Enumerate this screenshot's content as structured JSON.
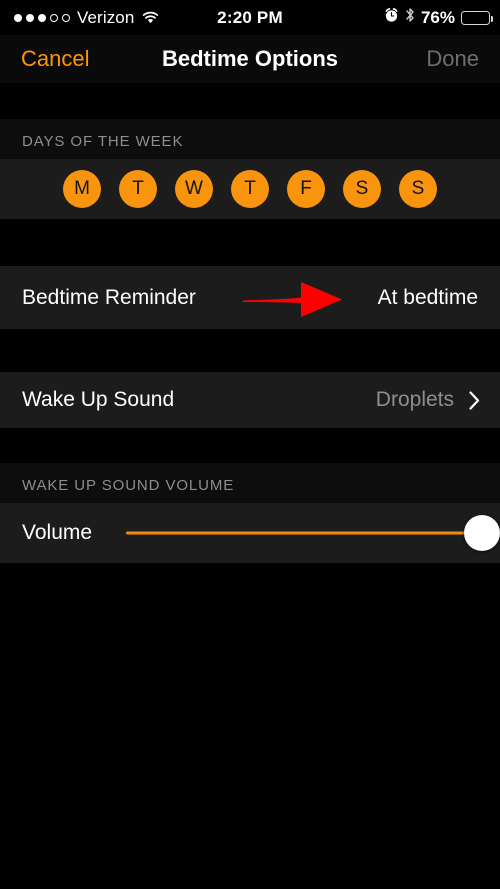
{
  "statusbar": {
    "carrier": "Verizon",
    "signal_filled": 3,
    "signal_empty": 2,
    "wifi_icon": "wifi-icon",
    "time": "2:20 PM",
    "alarm_icon": "alarm-clock-icon",
    "bluetooth_icon": "bluetooth-icon",
    "battery_percent": "76%",
    "battery_level": 76,
    "battery_color": "#ffcc00"
  },
  "navbar": {
    "cancel_label": "Cancel",
    "title": "Bedtime Options",
    "done_label": "Done",
    "accent_color": "#ff9500",
    "done_disabled_color": "#6e6e6e"
  },
  "days_section": {
    "header": "DAYS OF THE WEEK",
    "days": [
      {
        "label": "M",
        "name": "day-monday",
        "selected": true
      },
      {
        "label": "T",
        "name": "day-tuesday",
        "selected": true
      },
      {
        "label": "W",
        "name": "day-wednesday",
        "selected": true
      },
      {
        "label": "T",
        "name": "day-thursday",
        "selected": true
      },
      {
        "label": "F",
        "name": "day-friday",
        "selected": true
      },
      {
        "label": "S",
        "name": "day-saturday",
        "selected": true
      },
      {
        "label": "S",
        "name": "day-sunday",
        "selected": true
      }
    ],
    "selected_color": "#f8940d"
  },
  "bedtime_reminder": {
    "label": "Bedtime Reminder",
    "value": "At bedtime"
  },
  "wake_up_sound": {
    "label": "Wake Up Sound",
    "value": "Droplets",
    "chevron_icon": "chevron-right-icon"
  },
  "volume_section": {
    "header": "WAKE UP SOUND VOLUME",
    "label": "Volume",
    "value_percent": 100,
    "track_color": "#f08b0a",
    "thumb_color": "#ffffff"
  },
  "annotation": {
    "arrow_icon": "red-arrow-right-icon",
    "color": "#ff0000"
  }
}
